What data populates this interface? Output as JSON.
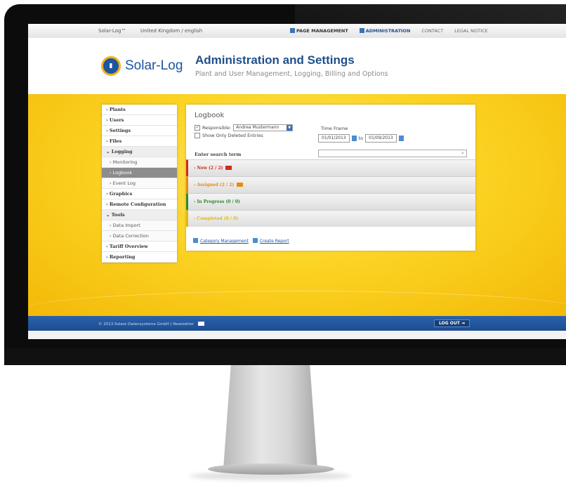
{
  "topbar": {
    "brand": "Solar-Log™",
    "lang": "United Kingdom / english",
    "nav": [
      "PAGE MANAGEMENT",
      "ADMINISTRATION",
      "CONTACT",
      "LEGAL NOTICE"
    ]
  },
  "header": {
    "logo_text": "Solar-Log",
    "title": "Administration and Settings",
    "subtitle": "Plant and User Management, Logging, Billing and Options"
  },
  "sidebar": {
    "items": [
      "Plants",
      "Users",
      "Settings",
      "Files",
      "Logging",
      "Monitoring",
      "Logbook",
      "Event Log",
      "Graphics",
      "Remote Configuration",
      "Tools",
      "Data Import",
      "Data Correction",
      "Tariff Overview",
      "Reporting"
    ]
  },
  "logbook": {
    "title": "Logbook",
    "responsible_label": "Responsible:",
    "responsible_value": "Andrea Mustermann",
    "deleted_label": "Show Only Deleted Entries",
    "timeframe_label": "Time Frame",
    "date_from": "01/01/2013",
    "to_label": "to",
    "date_to": "01/09/2013",
    "search_label": "Enter search term",
    "statuses": [
      {
        "label": "New (2 / 2)",
        "color": "#d12a1c"
      },
      {
        "label": "Assigned (2 / 2)",
        "color": "#e88a12"
      },
      {
        "label": "In Progress (0 / 0)",
        "color": "#2d8a2d"
      },
      {
        "label": "Completed (0 / 0)",
        "color": "#e3b80c"
      }
    ],
    "category_link": "Category Management",
    "report_link": "Create Report"
  },
  "footer": {
    "copyright": "© 2013 Solare Datensysteme GmbH | Newsletter",
    "logout": "LOG OUT"
  }
}
